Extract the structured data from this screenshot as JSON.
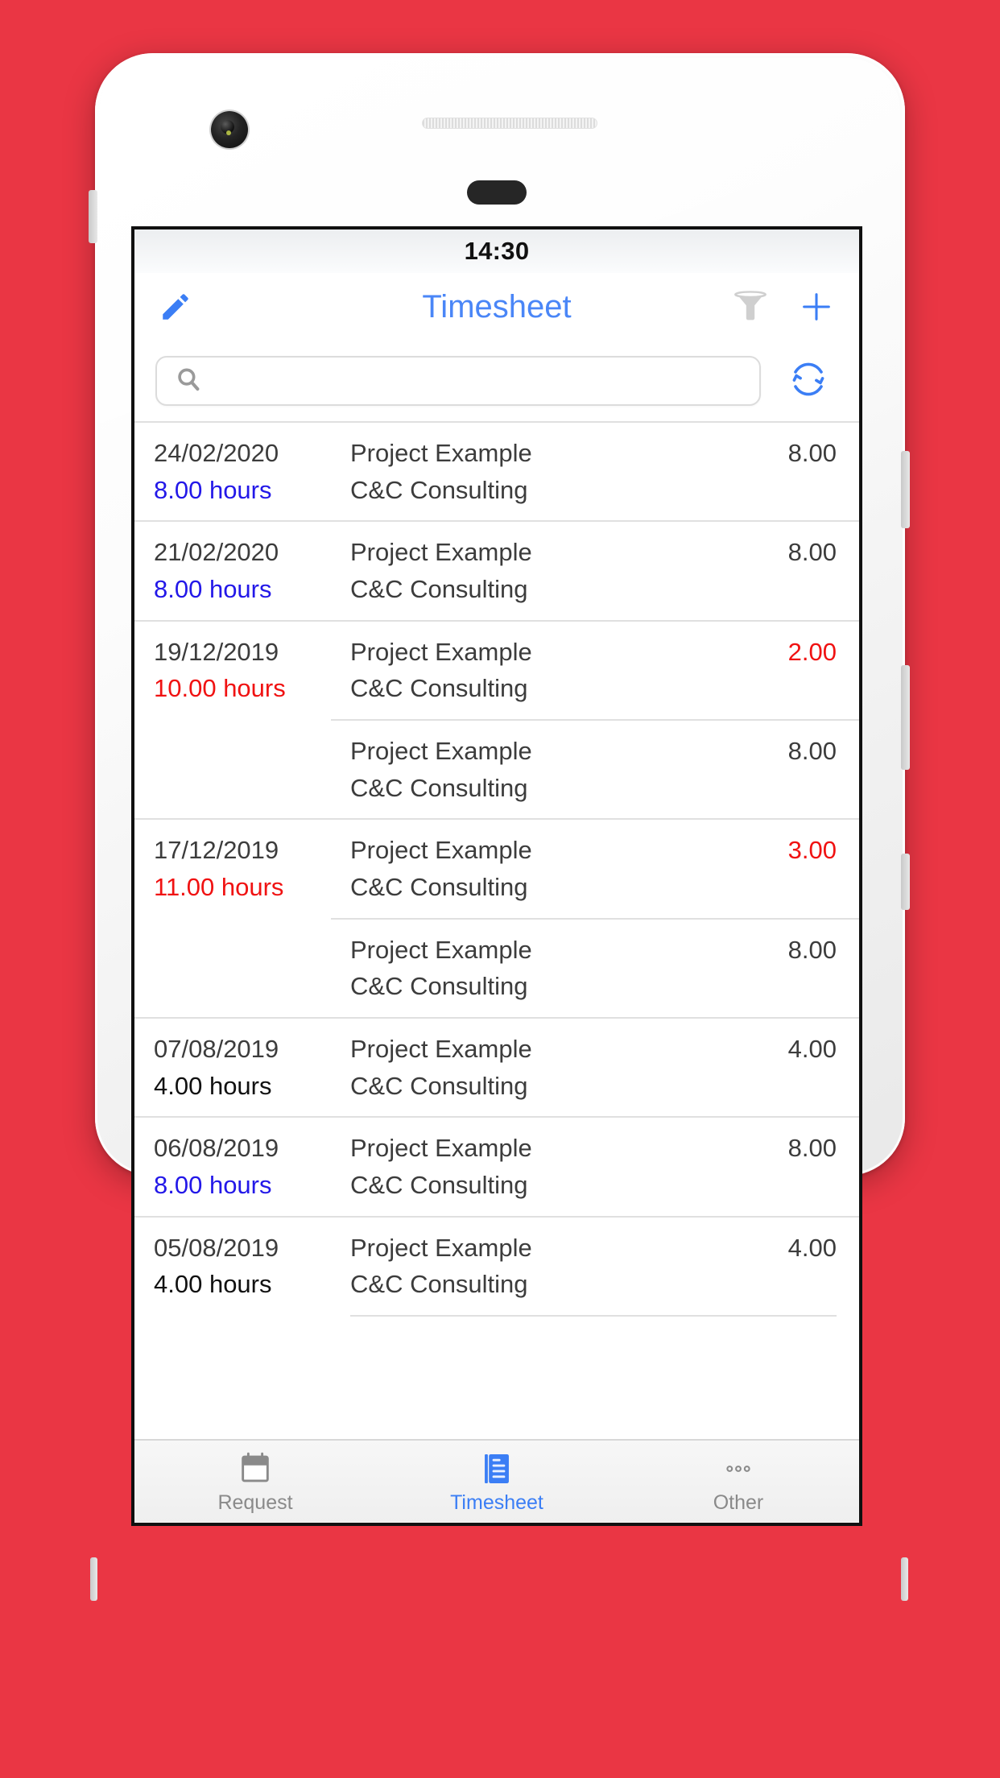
{
  "theme": {
    "background": "#ea3644",
    "accent_blue": "#4a86f7",
    "hours_blue": "#2318e8",
    "alert_red": "#f01212",
    "text_dark": "#3c3c3c"
  },
  "status_bar": {
    "time": "14:30"
  },
  "nav": {
    "title": "Timesheet",
    "edit_icon": "pencil-icon",
    "filter_icon": "funnel-icon",
    "add_icon": "plus-icon"
  },
  "search": {
    "placeholder": "",
    "value": "",
    "search_icon": "search-icon",
    "refresh_icon": "refresh-icon"
  },
  "list": {
    "rows": [
      {
        "date": "24/02/2020",
        "hours_total": "8.00 hours",
        "hours_color": "blue",
        "trailing_rule": false,
        "entries": [
          {
            "project": "Project Example",
            "client": "C&C Consulting",
            "amount": "8.00",
            "amount_color": "black"
          }
        ]
      },
      {
        "date": "21/02/2020",
        "hours_total": "8.00 hours",
        "hours_color": "blue",
        "trailing_rule": false,
        "entries": [
          {
            "project": "Project Example",
            "client": "C&C Consulting",
            "amount": "8.00",
            "amount_color": "black"
          }
        ]
      },
      {
        "date": "19/12/2019",
        "hours_total": "10.00 hours",
        "hours_color": "red",
        "trailing_rule": false,
        "entries": [
          {
            "project": "Project Example",
            "client": "C&C Consulting",
            "amount": "2.00",
            "amount_color": "red"
          },
          {
            "project": "Project Example",
            "client": "C&C Consulting",
            "amount": "8.00",
            "amount_color": "black"
          }
        ]
      },
      {
        "date": "17/12/2019",
        "hours_total": "11.00 hours",
        "hours_color": "red",
        "trailing_rule": false,
        "entries": [
          {
            "project": "Project Example",
            "client": "C&C Consulting",
            "amount": "3.00",
            "amount_color": "red"
          },
          {
            "project": "Project Example",
            "client": "C&C Consulting",
            "amount": "8.00",
            "amount_color": "black"
          }
        ]
      },
      {
        "date": "07/08/2019",
        "hours_total": "4.00 hours",
        "hours_color": "black",
        "trailing_rule": false,
        "entries": [
          {
            "project": "Project Example",
            "client": "C&C Consulting",
            "amount": "4.00",
            "amount_color": "black"
          }
        ]
      },
      {
        "date": "06/08/2019",
        "hours_total": "8.00 hours",
        "hours_color": "blue",
        "trailing_rule": false,
        "entries": [
          {
            "project": "Project Example",
            "client": "C&C Consulting",
            "amount": "8.00",
            "amount_color": "black"
          }
        ]
      },
      {
        "date": "05/08/2019",
        "hours_total": "4.00 hours",
        "hours_color": "black",
        "trailing_rule": true,
        "entries": [
          {
            "project": "Project Example",
            "client": "C&C Consulting",
            "amount": "4.00",
            "amount_color": "black"
          }
        ]
      }
    ]
  },
  "tabbar": {
    "tabs": [
      {
        "label": "Request",
        "icon": "calendar-icon",
        "active": false
      },
      {
        "label": "Timesheet",
        "icon": "document-lines-icon",
        "active": true
      },
      {
        "label": "Other",
        "icon": "ellipsis-icon",
        "active": false
      }
    ]
  }
}
